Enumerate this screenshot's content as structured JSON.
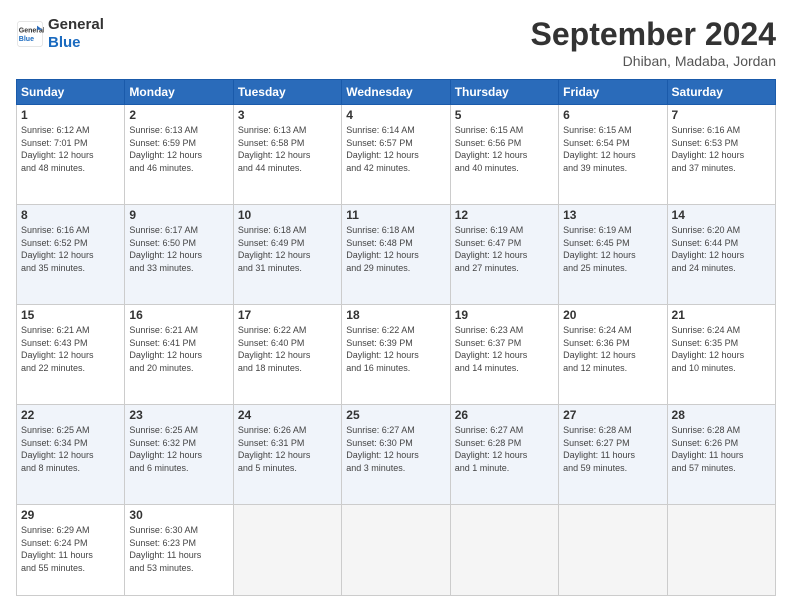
{
  "logo": {
    "line1": "General",
    "line2": "Blue"
  },
  "header": {
    "title": "September 2024",
    "location": "Dhiban, Madaba, Jordan"
  },
  "weekdays": [
    "Sunday",
    "Monday",
    "Tuesday",
    "Wednesday",
    "Thursday",
    "Friday",
    "Saturday"
  ],
  "weeks": [
    [
      {
        "day": "1",
        "info": "Sunrise: 6:12 AM\nSunset: 7:01 PM\nDaylight: 12 hours\nand 48 minutes."
      },
      {
        "day": "2",
        "info": "Sunrise: 6:13 AM\nSunset: 6:59 PM\nDaylight: 12 hours\nand 46 minutes."
      },
      {
        "day": "3",
        "info": "Sunrise: 6:13 AM\nSunset: 6:58 PM\nDaylight: 12 hours\nand 44 minutes."
      },
      {
        "day": "4",
        "info": "Sunrise: 6:14 AM\nSunset: 6:57 PM\nDaylight: 12 hours\nand 42 minutes."
      },
      {
        "day": "5",
        "info": "Sunrise: 6:15 AM\nSunset: 6:56 PM\nDaylight: 12 hours\nand 40 minutes."
      },
      {
        "day": "6",
        "info": "Sunrise: 6:15 AM\nSunset: 6:54 PM\nDaylight: 12 hours\nand 39 minutes."
      },
      {
        "day": "7",
        "info": "Sunrise: 6:16 AM\nSunset: 6:53 PM\nDaylight: 12 hours\nand 37 minutes."
      }
    ],
    [
      {
        "day": "8",
        "info": "Sunrise: 6:16 AM\nSunset: 6:52 PM\nDaylight: 12 hours\nand 35 minutes."
      },
      {
        "day": "9",
        "info": "Sunrise: 6:17 AM\nSunset: 6:50 PM\nDaylight: 12 hours\nand 33 minutes."
      },
      {
        "day": "10",
        "info": "Sunrise: 6:18 AM\nSunset: 6:49 PM\nDaylight: 12 hours\nand 31 minutes."
      },
      {
        "day": "11",
        "info": "Sunrise: 6:18 AM\nSunset: 6:48 PM\nDaylight: 12 hours\nand 29 minutes."
      },
      {
        "day": "12",
        "info": "Sunrise: 6:19 AM\nSunset: 6:47 PM\nDaylight: 12 hours\nand 27 minutes."
      },
      {
        "day": "13",
        "info": "Sunrise: 6:19 AM\nSunset: 6:45 PM\nDaylight: 12 hours\nand 25 minutes."
      },
      {
        "day": "14",
        "info": "Sunrise: 6:20 AM\nSunset: 6:44 PM\nDaylight: 12 hours\nand 24 minutes."
      }
    ],
    [
      {
        "day": "15",
        "info": "Sunrise: 6:21 AM\nSunset: 6:43 PM\nDaylight: 12 hours\nand 22 minutes."
      },
      {
        "day": "16",
        "info": "Sunrise: 6:21 AM\nSunset: 6:41 PM\nDaylight: 12 hours\nand 20 minutes."
      },
      {
        "day": "17",
        "info": "Sunrise: 6:22 AM\nSunset: 6:40 PM\nDaylight: 12 hours\nand 18 minutes."
      },
      {
        "day": "18",
        "info": "Sunrise: 6:22 AM\nSunset: 6:39 PM\nDaylight: 12 hours\nand 16 minutes."
      },
      {
        "day": "19",
        "info": "Sunrise: 6:23 AM\nSunset: 6:37 PM\nDaylight: 12 hours\nand 14 minutes."
      },
      {
        "day": "20",
        "info": "Sunrise: 6:24 AM\nSunset: 6:36 PM\nDaylight: 12 hours\nand 12 minutes."
      },
      {
        "day": "21",
        "info": "Sunrise: 6:24 AM\nSunset: 6:35 PM\nDaylight: 12 hours\nand 10 minutes."
      }
    ],
    [
      {
        "day": "22",
        "info": "Sunrise: 6:25 AM\nSunset: 6:34 PM\nDaylight: 12 hours\nand 8 minutes."
      },
      {
        "day": "23",
        "info": "Sunrise: 6:25 AM\nSunset: 6:32 PM\nDaylight: 12 hours\nand 6 minutes."
      },
      {
        "day": "24",
        "info": "Sunrise: 6:26 AM\nSunset: 6:31 PM\nDaylight: 12 hours\nand 5 minutes."
      },
      {
        "day": "25",
        "info": "Sunrise: 6:27 AM\nSunset: 6:30 PM\nDaylight: 12 hours\nand 3 minutes."
      },
      {
        "day": "26",
        "info": "Sunrise: 6:27 AM\nSunset: 6:28 PM\nDaylight: 12 hours\nand 1 minute."
      },
      {
        "day": "27",
        "info": "Sunrise: 6:28 AM\nSunset: 6:27 PM\nDaylight: 11 hours\nand 59 minutes."
      },
      {
        "day": "28",
        "info": "Sunrise: 6:28 AM\nSunset: 6:26 PM\nDaylight: 11 hours\nand 57 minutes."
      }
    ],
    [
      {
        "day": "29",
        "info": "Sunrise: 6:29 AM\nSunset: 6:24 PM\nDaylight: 11 hours\nand 55 minutes."
      },
      {
        "day": "30",
        "info": "Sunrise: 6:30 AM\nSunset: 6:23 PM\nDaylight: 11 hours\nand 53 minutes."
      },
      {
        "day": "",
        "info": ""
      },
      {
        "day": "",
        "info": ""
      },
      {
        "day": "",
        "info": ""
      },
      {
        "day": "",
        "info": ""
      },
      {
        "day": "",
        "info": ""
      }
    ]
  ]
}
